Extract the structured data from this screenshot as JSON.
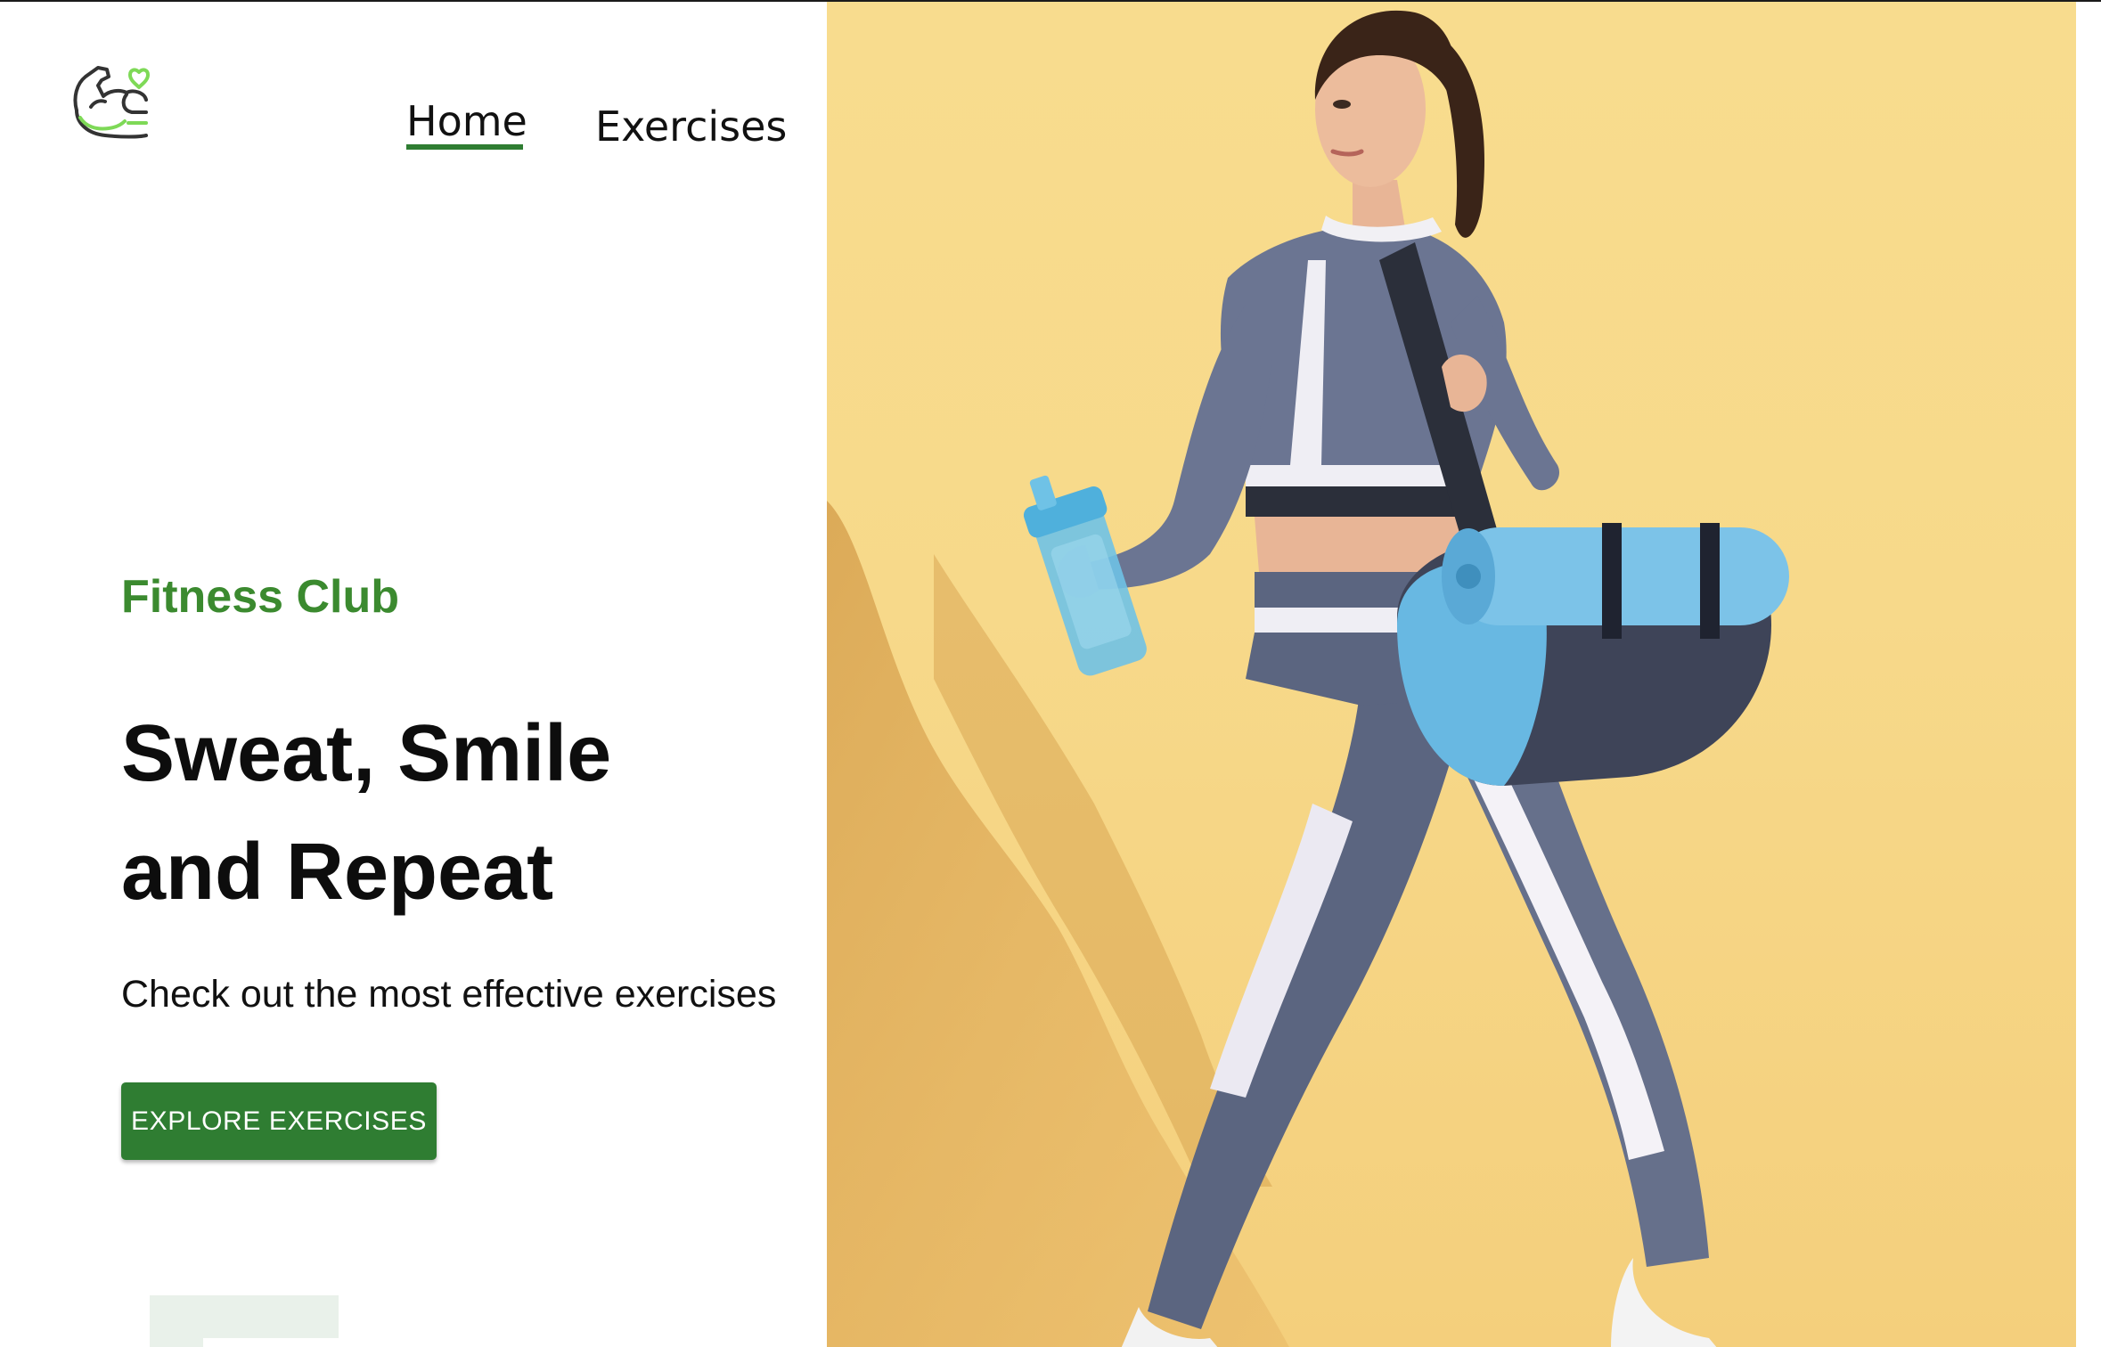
{
  "nav": {
    "home_label": "Home",
    "exercises_label": "Exercises",
    "active": "Home"
  },
  "logo": {
    "icon": "flexed-biceps-heart-icon"
  },
  "hero": {
    "kicker": "Fitness Club",
    "headline_line1": "Sweat, Smile",
    "headline_line2": "and Repeat",
    "subtext": "Check out the most effective exercises",
    "cta_label": "EXPLORE EXERCISES",
    "image_subject": "woman-walking-with-gym-bag-yoga-mat-and-shaker-bottle"
  },
  "colors": {
    "brand_green": "#2f7d32",
    "kicker_green": "#3b8a2f",
    "hero_background": "#f8dc8e",
    "heading_text": "#0d0d0d"
  }
}
